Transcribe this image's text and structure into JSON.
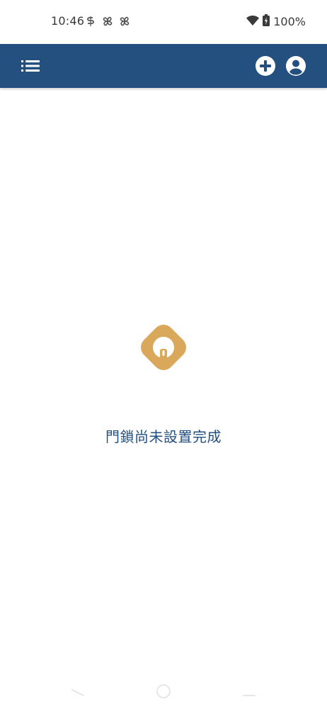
{
  "status_bar": {
    "time": "10:46",
    "battery": "100%"
  },
  "app_bar": {
    "color": "#24507f",
    "icons": [
      "list-menu-icon",
      "add-circle-icon",
      "account-circle-icon"
    ]
  },
  "empty_state": {
    "message": "門鎖尚未設置完成",
    "logo_color": "#d9a85a"
  }
}
